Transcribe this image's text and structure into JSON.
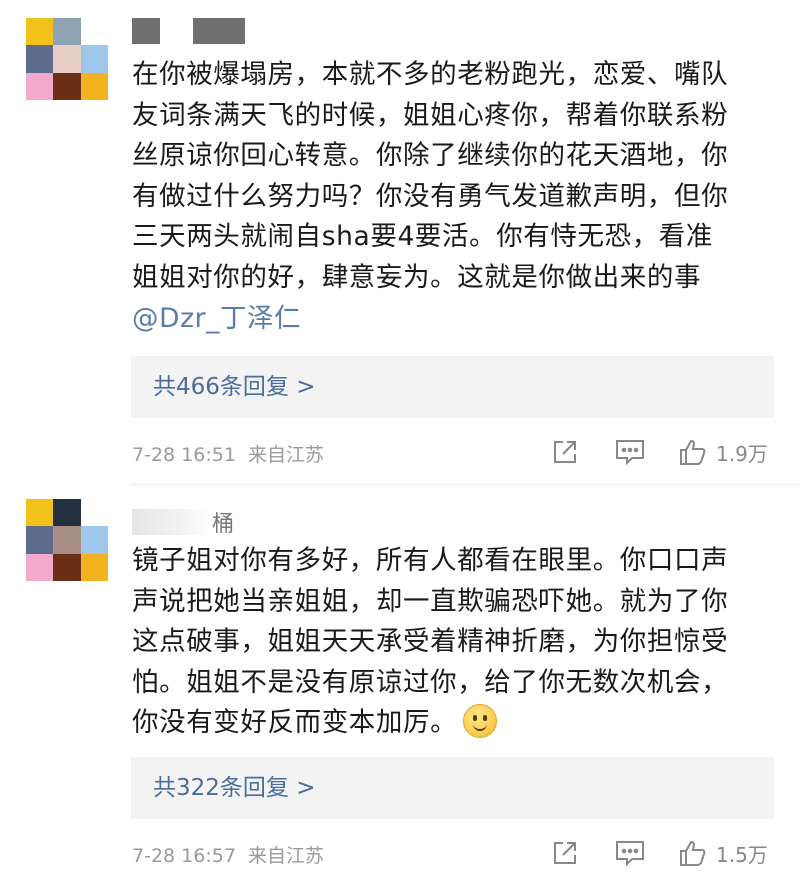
{
  "comments": [
    {
      "lines": [
        "在你被爆塌房，本就不多的老粉跑光，恋爱、嘴队",
        "友词条满天飞的时候，姐姐心疼你，帮着你联系粉",
        "丝原谅你回心转意。你除了继续你的花天酒地，你",
        "有做过什么努力吗？你没有勇气发道歉声明，但你",
        "三天两头就闹自sha要4要活。你有恃无恐，看准",
        "姐姐对你的好，肆意妄为。这就是你做出来的事"
      ],
      "mention": "@Dzr_丁泽仁",
      "replies": "共466条回复 >",
      "time": "7-28 16:51",
      "location": "来自江苏",
      "likes": "1.9万",
      "name_visible": ""
    },
    {
      "lines": [
        "镜子姐对你有多好，所有人都看在眼里。你口口声",
        "声说把她当亲姐姐，却一直欺骗恐吓她。就为了你",
        "这点破事，姐姐天天承受着精神折磨，为你担惊受",
        "怕。姐姐不是没有原谅过你，给了你无数次机会，",
        "你没有变好反而变本加厉。"
      ],
      "replies": "共322条回复 >",
      "time": "7-28 16:57",
      "location": "来自江苏",
      "likes": "1.5万",
      "name_visible": "桶"
    }
  ],
  "icons": {
    "share": "share-icon",
    "comment": "comment-icon",
    "like": "like-icon",
    "emoji": "smile-emoji-icon"
  },
  "colors": {
    "link": "#5b7ca8",
    "meta": "#9a9a9a",
    "reply_bg": "#f3f3f3"
  }
}
